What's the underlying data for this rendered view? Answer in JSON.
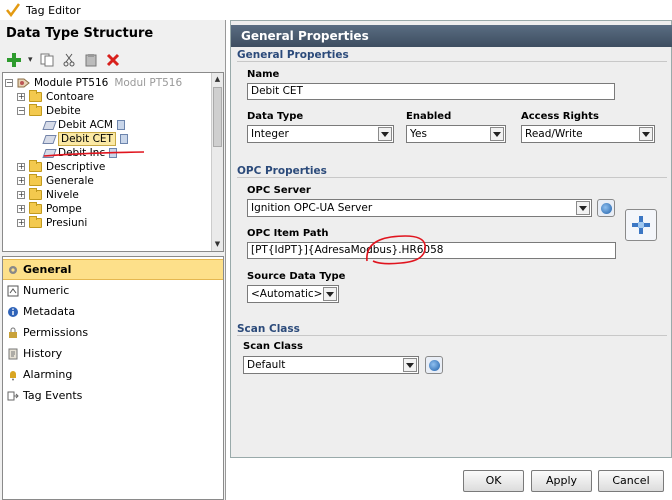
{
  "window": {
    "title": "Tag Editor"
  },
  "left": {
    "header": "Data Type Structure",
    "tree": [
      {
        "label": "Module PT516",
        "sublabel": "Modul PT516"
      },
      {
        "label": "Contoare"
      },
      {
        "label": "Debite"
      },
      {
        "label": "Debit ACM"
      },
      {
        "label": "Debit CET"
      },
      {
        "label": "Debit Inc"
      },
      {
        "label": "Descriptive"
      },
      {
        "label": "Generale"
      },
      {
        "label": "Nivele"
      },
      {
        "label": "Pompe"
      },
      {
        "label": "Presiuni"
      }
    ],
    "nav": [
      {
        "label": "General",
        "icon": "gear-icon"
      },
      {
        "label": "Numeric",
        "icon": "numeric-icon"
      },
      {
        "label": "Metadata",
        "icon": "info-icon"
      },
      {
        "label": "Permissions",
        "icon": "lock-icon"
      },
      {
        "label": "History",
        "icon": "history-icon"
      },
      {
        "label": "Alarming",
        "icon": "bell-icon"
      },
      {
        "label": "Tag Events",
        "icon": "events-icon"
      }
    ]
  },
  "right": {
    "header": "General Properties",
    "general_section": "General Properties",
    "name_label": "Name",
    "name_value": "Debit CET",
    "data_type_label": "Data Type",
    "data_type_value": "Integer",
    "enabled_label": "Enabled",
    "enabled_value": "Yes",
    "access_label": "Access Rights",
    "access_value": "Read/Write",
    "opc_section": "OPC Properties",
    "opc_server_label": "OPC Server",
    "opc_server_value": "Ignition OPC-UA Server",
    "opc_item_label": "OPC Item Path",
    "opc_item_value": "[PT{IdPT}]{AdresaModbus}.HR6058",
    "source_type_label": "Source Data Type",
    "source_type_value": "<Automatic>",
    "scan_section": "Scan Class",
    "scan_label": "Scan Class",
    "scan_value": "Default"
  },
  "buttons": {
    "ok": "OK",
    "apply": "Apply",
    "cancel": "Cancel"
  },
  "colors": {
    "header_bg": "#4a5b6e",
    "selected_nav": "#fde08a",
    "annotation_red": "#e0141e"
  }
}
